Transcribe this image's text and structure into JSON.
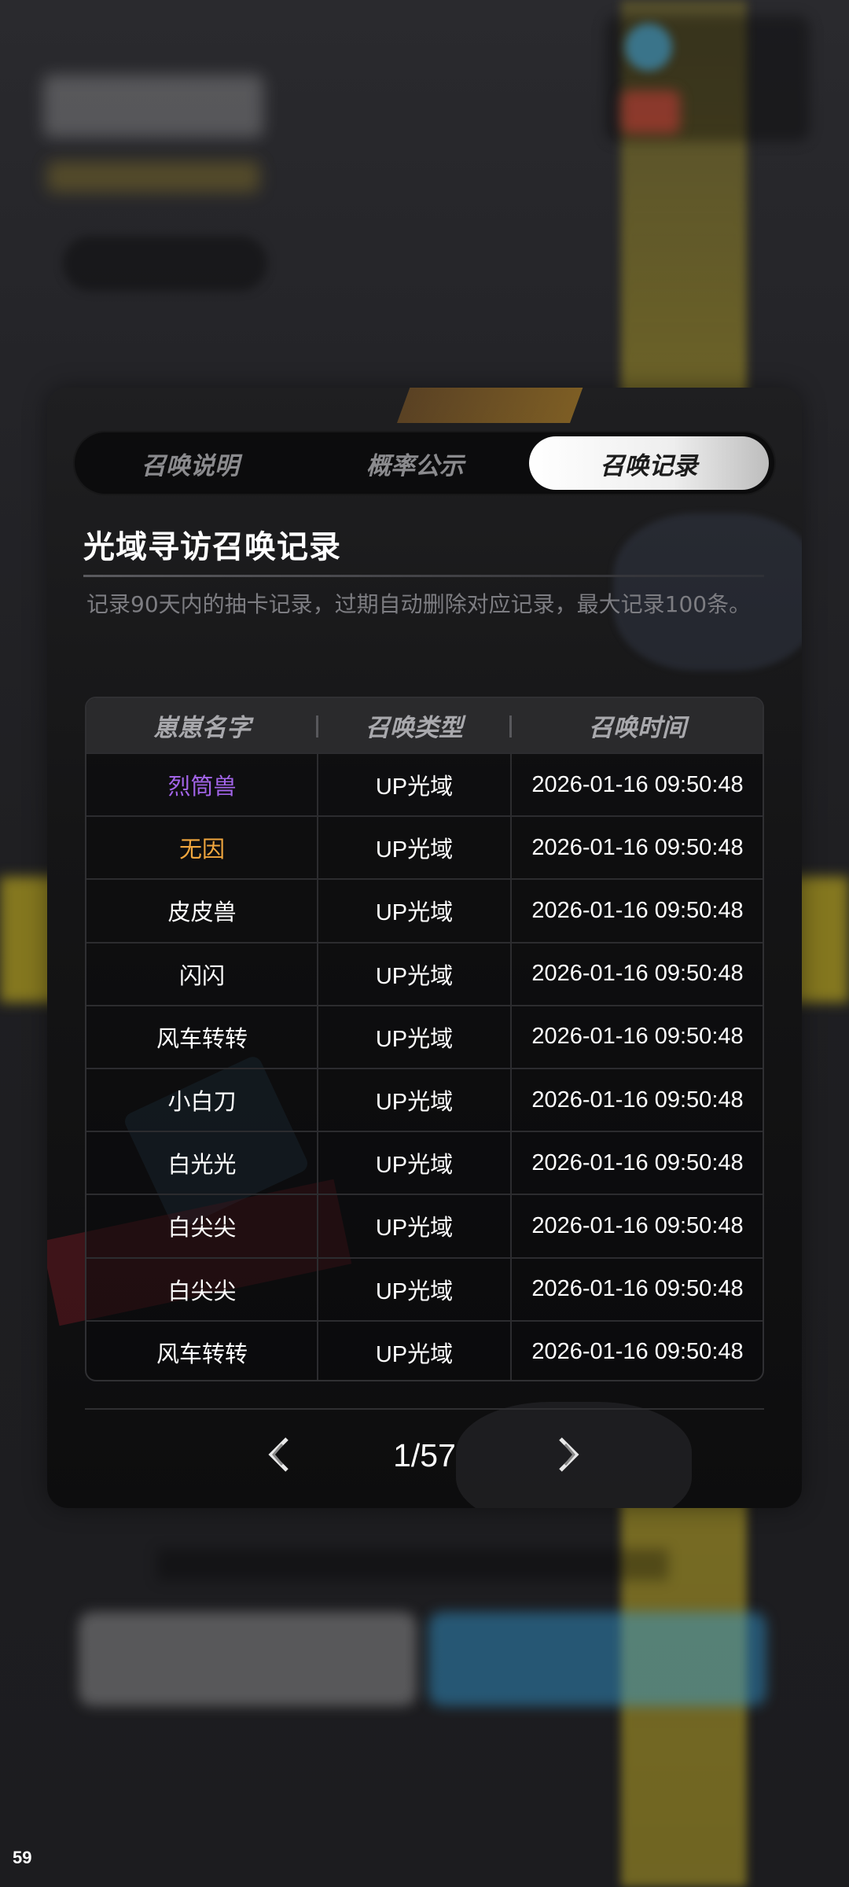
{
  "tabs": [
    {
      "label": "召唤说明",
      "active": false
    },
    {
      "label": "概率公示",
      "active": false
    },
    {
      "label": "召唤记录",
      "active": true
    }
  ],
  "record": {
    "title": "光域寻访召唤记录",
    "description": "记录90天内的抽卡记录，过期自动删除对应记录，最大记录100条。"
  },
  "table": {
    "headers": [
      "崽崽名字",
      "召唤类型",
      "召唤时间"
    ],
    "rows": [
      {
        "name": "烈筒兽",
        "type": "UP光域",
        "time": "2026-01-16 09:50:48",
        "name_color": "#a264e8"
      },
      {
        "name": "无因",
        "type": "UP光域",
        "time": "2026-01-16 09:50:48",
        "name_color": "#f0a63e"
      },
      {
        "name": "皮皮兽",
        "type": "UP光域",
        "time": "2026-01-16 09:50:48",
        "name_color": "#ffffff"
      },
      {
        "name": "闪闪",
        "type": "UP光域",
        "time": "2026-01-16 09:50:48",
        "name_color": "#ffffff"
      },
      {
        "name": "风车转转",
        "type": "UP光域",
        "time": "2026-01-16 09:50:48",
        "name_color": "#ffffff"
      },
      {
        "name": "小白刀",
        "type": "UP光域",
        "time": "2026-01-16 09:50:48",
        "name_color": "#ffffff"
      },
      {
        "name": "白光光",
        "type": "UP光域",
        "time": "2026-01-16 09:50:48",
        "name_color": "#ffffff"
      },
      {
        "name": "白尖尖",
        "type": "UP光域",
        "time": "2026-01-16 09:50:48",
        "name_color": "#ffffff"
      },
      {
        "name": "白尖尖",
        "type": "UP光域",
        "time": "2026-01-16 09:50:48",
        "name_color": "#ffffff"
      },
      {
        "name": "风车转转",
        "type": "UP光域",
        "time": "2026-01-16 09:50:48",
        "name_color": "#ffffff"
      }
    ]
  },
  "pagination": {
    "text": "1/57",
    "prev_icon": "chevron-left-icon",
    "next_icon": "chevron-right-icon"
  },
  "fps_counter": "59"
}
